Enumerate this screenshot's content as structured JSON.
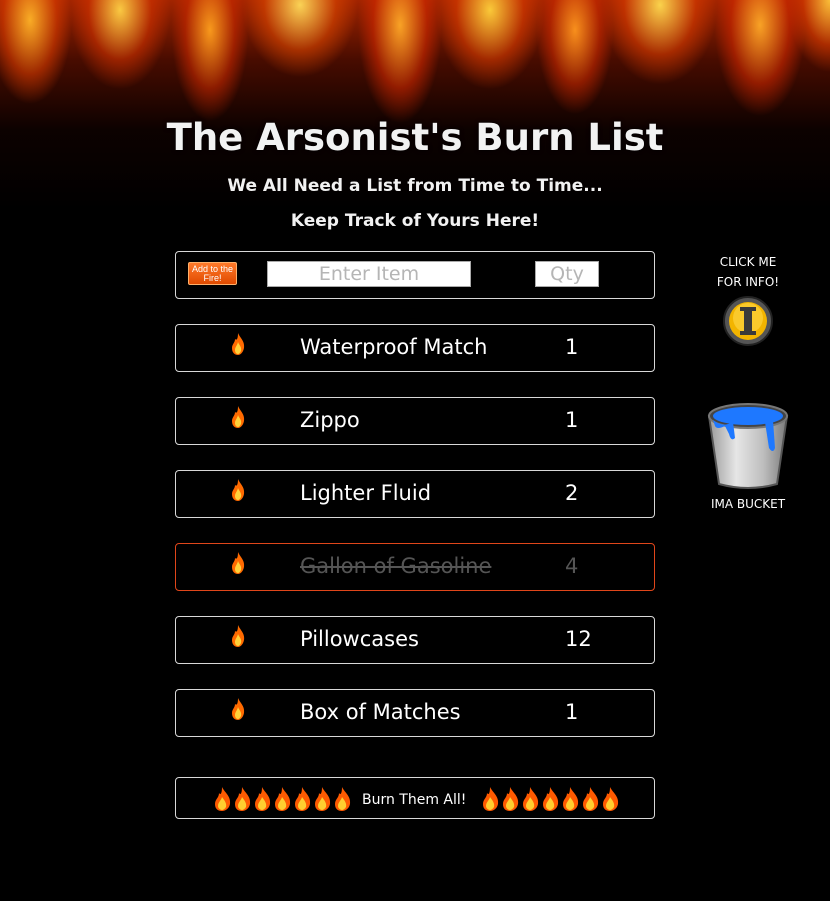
{
  "header": {
    "title": "The Arsonist's Burn List",
    "subtitle1": "We All Need a List from Time to Time...",
    "subtitle2": "Keep Track of Yours Here!"
  },
  "add_form": {
    "button_label": "Add to the Fire!",
    "item_placeholder": "Enter Item",
    "qty_placeholder": "Qty"
  },
  "items": [
    {
      "name": "Waterproof Match",
      "qty": "1",
      "done": false
    },
    {
      "name": "Zippo",
      "qty": "1",
      "done": false
    },
    {
      "name": "Lighter Fluid",
      "qty": "2",
      "done": false
    },
    {
      "name": "Gallon of Gasoline",
      "qty": "4",
      "done": true
    },
    {
      "name": "Pillowcases",
      "qty": "12",
      "done": false
    },
    {
      "name": "Box of Matches",
      "qty": "1",
      "done": false
    }
  ],
  "burn_all": {
    "label": "Burn Them All!"
  },
  "info": {
    "line1": "CLICK ME",
    "line2": "FOR INFO!",
    "icon": "info-icon"
  },
  "bucket": {
    "label": "IMA BUCKET",
    "icon": "bucket-icon"
  },
  "colors": {
    "accent": "#e0461a",
    "button": "#ff6a1a"
  }
}
